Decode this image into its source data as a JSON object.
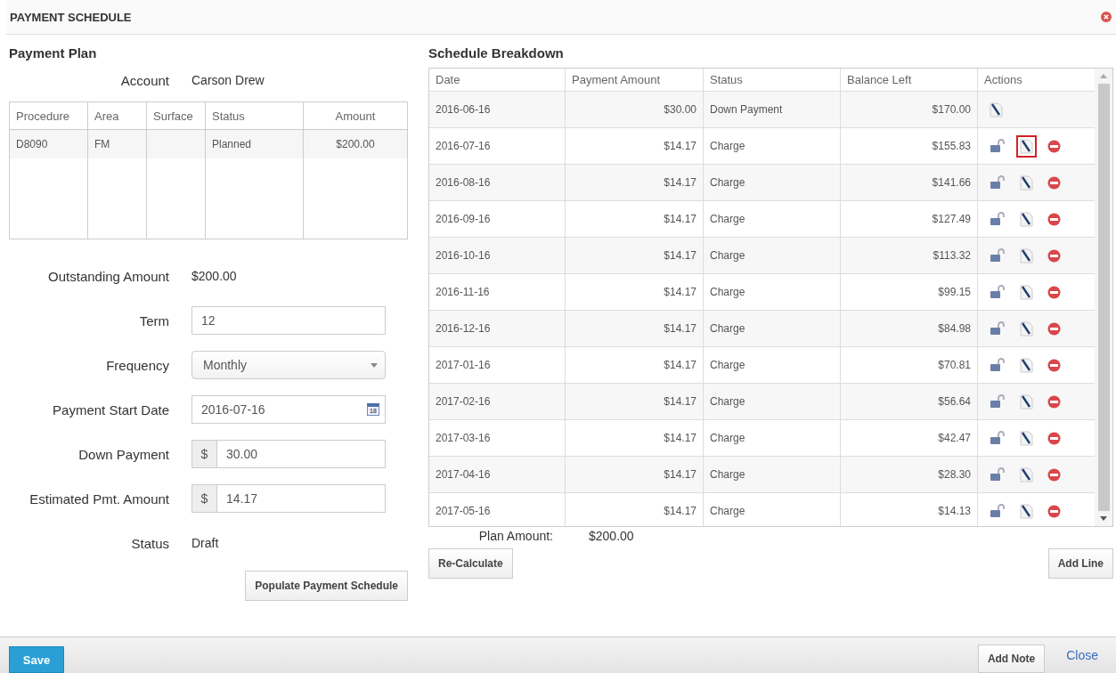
{
  "dialog": {
    "title": "PAYMENT SCHEDULE"
  },
  "plan": {
    "heading": "Payment Plan",
    "account_label": "Account",
    "account_value": "Carson Drew",
    "procedures": {
      "columns": [
        "Procedure",
        "Area",
        "Surface",
        "Status",
        "Amount"
      ],
      "rows": [
        [
          "D8090",
          "FM",
          "",
          "Planned",
          "$200.00"
        ]
      ]
    },
    "fields": [
      {
        "kind": "text",
        "label": "Outstanding Amount",
        "value": "$200.00"
      },
      {
        "kind": "input",
        "label": "Term",
        "value": "12"
      },
      {
        "kind": "select",
        "label": "Frequency",
        "value": "Monthly"
      },
      {
        "kind": "date",
        "label": "Payment Start Date",
        "value": "2016-07-16",
        "icon_text": "18"
      },
      {
        "kind": "money",
        "label": "Down Payment",
        "prefix": "$",
        "value": "30.00"
      },
      {
        "kind": "money",
        "label": "Estimated Pmt. Amount",
        "prefix": "$",
        "value": "14.17"
      },
      {
        "kind": "text",
        "label": "Status",
        "value": "Draft"
      }
    ],
    "populate_button": "Populate Payment Schedule"
  },
  "schedule": {
    "heading": "Schedule Breakdown",
    "columns": [
      "Date",
      "Payment Amount",
      "Status",
      "Balance Left",
      "Actions"
    ],
    "rows": [
      {
        "date": "2016-06-16",
        "amount": "$30.00",
        "status": "Down Payment",
        "balance": "$170.00",
        "actions": [
          {
            "kind": "edit",
            "highlighted": false
          }
        ]
      },
      {
        "date": "2016-07-16",
        "amount": "$14.17",
        "status": "Charge",
        "balance": "$155.83",
        "actions": [
          {
            "kind": "lock",
            "highlighted": false
          },
          {
            "kind": "edit",
            "highlighted": true
          },
          {
            "kind": "delete",
            "highlighted": false
          }
        ]
      },
      {
        "date": "2016-08-16",
        "amount": "$14.17",
        "status": "Charge",
        "balance": "$141.66",
        "actions": [
          {
            "kind": "lock",
            "highlighted": false
          },
          {
            "kind": "edit",
            "highlighted": false
          },
          {
            "kind": "delete",
            "highlighted": false
          }
        ]
      },
      {
        "date": "2016-09-16",
        "amount": "$14.17",
        "status": "Charge",
        "balance": "$127.49",
        "actions": [
          {
            "kind": "lock",
            "highlighted": false
          },
          {
            "kind": "edit",
            "highlighted": false
          },
          {
            "kind": "delete",
            "highlighted": false
          }
        ]
      },
      {
        "date": "2016-10-16",
        "amount": "$14.17",
        "status": "Charge",
        "balance": "$113.32",
        "actions": [
          {
            "kind": "lock",
            "highlighted": false
          },
          {
            "kind": "edit",
            "highlighted": false
          },
          {
            "kind": "delete",
            "highlighted": false
          }
        ]
      },
      {
        "date": "2016-11-16",
        "amount": "$14.17",
        "status": "Charge",
        "balance": "$99.15",
        "actions": [
          {
            "kind": "lock",
            "highlighted": false
          },
          {
            "kind": "edit",
            "highlighted": false
          },
          {
            "kind": "delete",
            "highlighted": false
          }
        ]
      },
      {
        "date": "2016-12-16",
        "amount": "$14.17",
        "status": "Charge",
        "balance": "$84.98",
        "actions": [
          {
            "kind": "lock",
            "highlighted": false
          },
          {
            "kind": "edit",
            "highlighted": false
          },
          {
            "kind": "delete",
            "highlighted": false
          }
        ]
      },
      {
        "date": "2017-01-16",
        "amount": "$14.17",
        "status": "Charge",
        "balance": "$70.81",
        "actions": [
          {
            "kind": "lock",
            "highlighted": false
          },
          {
            "kind": "edit",
            "highlighted": false
          },
          {
            "kind": "delete",
            "highlighted": false
          }
        ]
      },
      {
        "date": "2017-02-16",
        "amount": "$14.17",
        "status": "Charge",
        "balance": "$56.64",
        "actions": [
          {
            "kind": "lock",
            "highlighted": false
          },
          {
            "kind": "edit",
            "highlighted": false
          },
          {
            "kind": "delete",
            "highlighted": false
          }
        ]
      },
      {
        "date": "2017-03-16",
        "amount": "$14.17",
        "status": "Charge",
        "balance": "$42.47",
        "actions": [
          {
            "kind": "lock",
            "highlighted": false
          },
          {
            "kind": "edit",
            "highlighted": false
          },
          {
            "kind": "delete",
            "highlighted": false
          }
        ]
      },
      {
        "date": "2017-04-16",
        "amount": "$14.17",
        "status": "Charge",
        "balance": "$28.30",
        "actions": [
          {
            "kind": "lock",
            "highlighted": false
          },
          {
            "kind": "edit",
            "highlighted": false
          },
          {
            "kind": "delete",
            "highlighted": false
          }
        ]
      },
      {
        "date": "2017-05-16",
        "amount": "$14.17",
        "status": "Charge",
        "balance": "$14.13",
        "actions": [
          {
            "kind": "lock",
            "highlighted": false
          },
          {
            "kind": "edit",
            "highlighted": false
          },
          {
            "kind": "delete",
            "highlighted": false
          }
        ]
      }
    ],
    "plan_amount_label": "Plan Amount:",
    "plan_amount_value": "$200.00",
    "recalculate_button": "Re-Calculate",
    "add_line_button": "Add Line"
  },
  "footer": {
    "save_button": "Save",
    "add_note_button": "Add Note",
    "close_link": "Close"
  }
}
